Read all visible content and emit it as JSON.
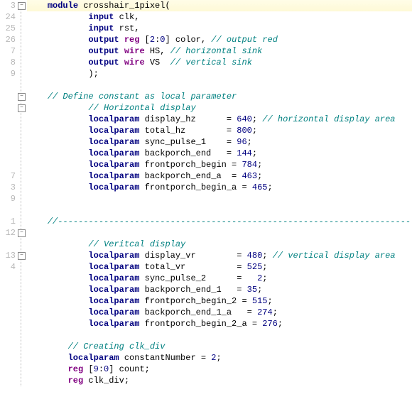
{
  "gutter": [
    "3",
    "24",
    "25",
    "26",
    "7",
    "8",
    "9",
    "",
    "",
    "",
    "",
    "",
    "",
    "",
    "",
    "7",
    "3",
    "9",
    "",
    "1",
    "12",
    "",
    "13",
    "4",
    "",
    "",
    "",
    "",
    "",
    "",
    "",
    "",
    "",
    "",
    ""
  ],
  "fold_boxes": [
    {
      "row": 0,
      "sym": "−"
    },
    {
      "row": 8,
      "sym": "−"
    },
    {
      "row": 9,
      "sym": "−"
    },
    {
      "row": 20,
      "sym": "−"
    },
    {
      "row": 22,
      "sym": "−"
    }
  ],
  "lines": [
    {
      "indent": 1,
      "hl": true,
      "tokens": [
        {
          "t": "module ",
          "c": "kw"
        },
        {
          "t": "crosshair_1pixel",
          "c": "ident"
        },
        {
          "t": "(",
          "c": "op"
        }
      ]
    },
    {
      "indent": 3,
      "tokens": [
        {
          "t": "input ",
          "c": "kw"
        },
        {
          "t": "clk",
          "c": "ident"
        },
        {
          "t": ",",
          "c": "op"
        }
      ]
    },
    {
      "indent": 3,
      "tokens": [
        {
          "t": "input ",
          "c": "kw"
        },
        {
          "t": "rst",
          "c": "ident"
        },
        {
          "t": ",",
          "c": "op"
        }
      ]
    },
    {
      "indent": 3,
      "tokens": [
        {
          "t": "output ",
          "c": "kw"
        },
        {
          "t": "reg ",
          "c": "kw2"
        },
        {
          "t": "[",
          "c": "op"
        },
        {
          "t": "2",
          "c": "num"
        },
        {
          "t": ":",
          "c": "op"
        },
        {
          "t": "0",
          "c": "num"
        },
        {
          "t": "] color, ",
          "c": "ident"
        },
        {
          "t": "// output red",
          "c": "cmt"
        }
      ]
    },
    {
      "indent": 3,
      "tokens": [
        {
          "t": "output ",
          "c": "kw"
        },
        {
          "t": "wire ",
          "c": "kw2"
        },
        {
          "t": "HS, ",
          "c": "ident"
        },
        {
          "t": "// horizontal sink",
          "c": "cmt"
        }
      ]
    },
    {
      "indent": 3,
      "tokens": [
        {
          "t": "output ",
          "c": "kw"
        },
        {
          "t": "wire ",
          "c": "kw2"
        },
        {
          "t": "VS  ",
          "c": "ident"
        },
        {
          "t": "// vertical sink",
          "c": "cmt"
        }
      ]
    },
    {
      "indent": 3,
      "tokens": [
        {
          "t": ");",
          "c": "op"
        }
      ]
    },
    {
      "indent": 0,
      "tokens": [
        {
          "t": "",
          "c": ""
        }
      ]
    },
    {
      "indent": 1,
      "tokens": [
        {
          "t": "// Define constant as local parameter",
          "c": "cmt"
        }
      ]
    },
    {
      "indent": 3,
      "tokens": [
        {
          "t": "// Horizontal display",
          "c": "cmt"
        }
      ]
    },
    {
      "indent": 3,
      "tokens": [
        {
          "t": "localparam ",
          "c": "kw"
        },
        {
          "t": "display_hz      = ",
          "c": "ident"
        },
        {
          "t": "640",
          "c": "num"
        },
        {
          "t": "; ",
          "c": "op"
        },
        {
          "t": "// horizontal display area",
          "c": "cmt"
        }
      ]
    },
    {
      "indent": 3,
      "tokens": [
        {
          "t": "localparam ",
          "c": "kw"
        },
        {
          "t": "total_hz        = ",
          "c": "ident"
        },
        {
          "t": "800",
          "c": "num"
        },
        {
          "t": ";",
          "c": "op"
        }
      ]
    },
    {
      "indent": 3,
      "tokens": [
        {
          "t": "localparam ",
          "c": "kw"
        },
        {
          "t": "sync_pulse_1    = ",
          "c": "ident"
        },
        {
          "t": "96",
          "c": "num"
        },
        {
          "t": ";",
          "c": "op"
        }
      ]
    },
    {
      "indent": 3,
      "tokens": [
        {
          "t": "localparam ",
          "c": "kw"
        },
        {
          "t": "backporch_end   = ",
          "c": "ident"
        },
        {
          "t": "144",
          "c": "num"
        },
        {
          "t": ";",
          "c": "op"
        }
      ]
    },
    {
      "indent": 3,
      "tokens": [
        {
          "t": "localparam ",
          "c": "kw"
        },
        {
          "t": "frontporch_begin = ",
          "c": "ident"
        },
        {
          "t": "784",
          "c": "num"
        },
        {
          "t": ";",
          "c": "op"
        }
      ]
    },
    {
      "indent": 3,
      "tokens": [
        {
          "t": "localparam ",
          "c": "kw"
        },
        {
          "t": "backporch_end_a  = ",
          "c": "ident"
        },
        {
          "t": "463",
          "c": "num"
        },
        {
          "t": ";",
          "c": "op"
        }
      ]
    },
    {
      "indent": 3,
      "tokens": [
        {
          "t": "localparam ",
          "c": "kw"
        },
        {
          "t": "frontporch_begin_a = ",
          "c": "ident"
        },
        {
          "t": "465",
          "c": "num"
        },
        {
          "t": ";",
          "c": "op"
        }
      ]
    },
    {
      "indent": 0,
      "tokens": [
        {
          "t": "",
          "c": ""
        }
      ]
    },
    {
      "indent": 0,
      "tokens": [
        {
          "t": "",
          "c": ""
        }
      ]
    },
    {
      "indent": 1,
      "tokens": [
        {
          "t": "//---------------------------------------------------------------------",
          "c": "dashline cmt"
        }
      ]
    },
    {
      "indent": 0,
      "tokens": [
        {
          "t": "",
          "c": ""
        }
      ]
    },
    {
      "indent": 3,
      "tokens": [
        {
          "t": "// Veritcal display",
          "c": "cmt"
        }
      ]
    },
    {
      "indent": 3,
      "tokens": [
        {
          "t": "localparam ",
          "c": "kw"
        },
        {
          "t": "display_vr        = ",
          "c": "ident"
        },
        {
          "t": "480",
          "c": "num"
        },
        {
          "t": "; ",
          "c": "op"
        },
        {
          "t": "// vertical display area",
          "c": "cmt"
        }
      ]
    },
    {
      "indent": 3,
      "tokens": [
        {
          "t": "localparam ",
          "c": "kw"
        },
        {
          "t": "total_vr          = ",
          "c": "ident"
        },
        {
          "t": "525",
          "c": "num"
        },
        {
          "t": ";",
          "c": "op"
        }
      ]
    },
    {
      "indent": 3,
      "tokens": [
        {
          "t": "localparam ",
          "c": "kw"
        },
        {
          "t": "sync_pulse_2      =   ",
          "c": "ident"
        },
        {
          "t": "2",
          "c": "num"
        },
        {
          "t": ";",
          "c": "op"
        }
      ]
    },
    {
      "indent": 3,
      "tokens": [
        {
          "t": "localparam ",
          "c": "kw"
        },
        {
          "t": "backporch_end_1   = ",
          "c": "ident"
        },
        {
          "t": "35",
          "c": "num"
        },
        {
          "t": ";",
          "c": "op"
        }
      ]
    },
    {
      "indent": 3,
      "tokens": [
        {
          "t": "localparam ",
          "c": "kw"
        },
        {
          "t": "frontporch_begin_2 = ",
          "c": "ident"
        },
        {
          "t": "515",
          "c": "num"
        },
        {
          "t": ";",
          "c": "op"
        }
      ]
    },
    {
      "indent": 3,
      "tokens": [
        {
          "t": "localparam ",
          "c": "kw"
        },
        {
          "t": "backporch_end_1_a   = ",
          "c": "ident"
        },
        {
          "t": "274",
          "c": "num"
        },
        {
          "t": ";",
          "c": "op"
        }
      ]
    },
    {
      "indent": 3,
      "tokens": [
        {
          "t": "localparam ",
          "c": "kw"
        },
        {
          "t": "frontporch_begin_2_a = ",
          "c": "ident"
        },
        {
          "t": "276",
          "c": "num"
        },
        {
          "t": ";",
          "c": "op"
        }
      ]
    },
    {
      "indent": 0,
      "tokens": [
        {
          "t": "",
          "c": ""
        }
      ]
    },
    {
      "indent": 2,
      "tokens": [
        {
          "t": "// Creating clk_div",
          "c": "cmt"
        }
      ]
    },
    {
      "indent": 2,
      "tokens": [
        {
          "t": "localparam ",
          "c": "kw"
        },
        {
          "t": "constantNumber = ",
          "c": "ident"
        },
        {
          "t": "2",
          "c": "num"
        },
        {
          "t": ";",
          "c": "op"
        }
      ]
    },
    {
      "indent": 2,
      "tokens": [
        {
          "t": "reg ",
          "c": "kw2"
        },
        {
          "t": "[",
          "c": "op"
        },
        {
          "t": "9",
          "c": "num"
        },
        {
          "t": ":",
          "c": "op"
        },
        {
          "t": "0",
          "c": "num"
        },
        {
          "t": "] count;",
          "c": "ident"
        }
      ]
    },
    {
      "indent": 2,
      "tokens": [
        {
          "t": "reg ",
          "c": "kw2"
        },
        {
          "t": "clk_div;",
          "c": "ident"
        }
      ]
    }
  ]
}
